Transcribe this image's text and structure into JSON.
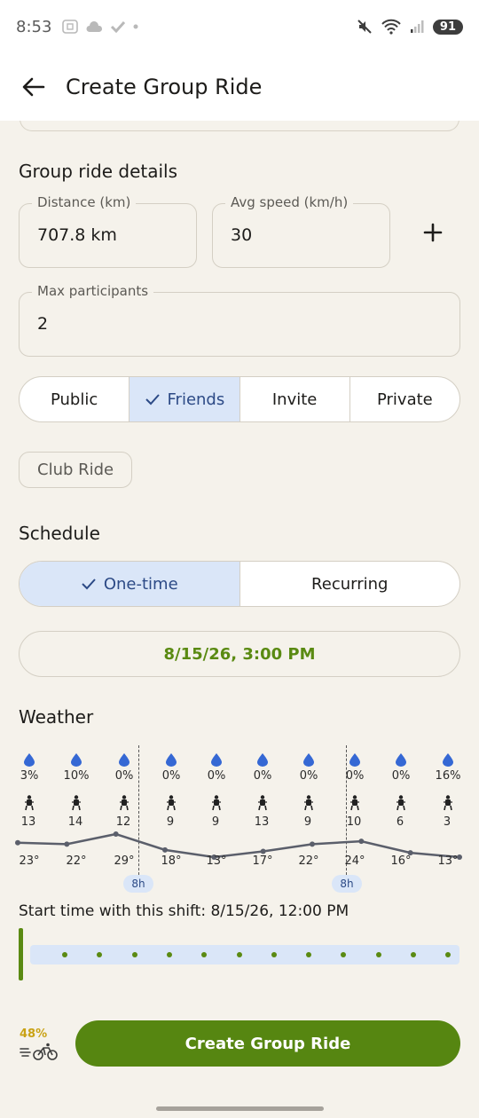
{
  "status_bar": {
    "time": "8:53",
    "battery": "91"
  },
  "header": {
    "title": "Create Group Ride"
  },
  "group_ride_details": {
    "section_title": "Group ride details",
    "distance": {
      "label": "Distance (km)",
      "value": "707.8 km"
    },
    "avg_speed": {
      "label": "Avg speed (km/h)",
      "value": "30"
    },
    "max_participants": {
      "label": "Max participants",
      "value": "2"
    },
    "visibility": {
      "options": [
        "Public",
        "Friends",
        "Invite",
        "Private"
      ],
      "selected": "Friends"
    },
    "club_ride_chip": "Club Ride"
  },
  "schedule": {
    "section_title": "Schedule",
    "options": [
      "One-time",
      "Recurring"
    ],
    "selected": "One-time",
    "datetime": "8/15/26, 3:00 PM"
  },
  "weather": {
    "section_title": "Weather",
    "hours": [
      {
        "precip": "3%",
        "wind": "13",
        "temp": "23°"
      },
      {
        "precip": "10%",
        "wind": "14",
        "temp": "22°"
      },
      {
        "precip": "0%",
        "wind": "12",
        "temp": "29°"
      },
      {
        "precip": "0%",
        "wind": "9",
        "temp": "18°"
      },
      {
        "precip": "0%",
        "wind": "9",
        "temp": "13°"
      },
      {
        "precip": "0%",
        "wind": "13",
        "temp": "17°"
      },
      {
        "precip": "0%",
        "wind": "9",
        "temp": "22°"
      },
      {
        "precip": "0%",
        "wind": "10",
        "temp": "24°"
      },
      {
        "precip": "0%",
        "wind": "6",
        "temp": "16°"
      },
      {
        "precip": "16%",
        "wind": "3",
        "temp": "13°"
      }
    ],
    "shift_badges": [
      "8h",
      "8h"
    ],
    "shift_text": "Start time with this shift: 8/15/26, 12:00 PM"
  },
  "footer": {
    "percent": "48%",
    "create_label": "Create Group Ride"
  },
  "colors": {
    "accent_green": "#568611",
    "selected_blue": "#dae6f8",
    "selected_text": "#2c4a86",
    "background": "#f5f2eb"
  }
}
